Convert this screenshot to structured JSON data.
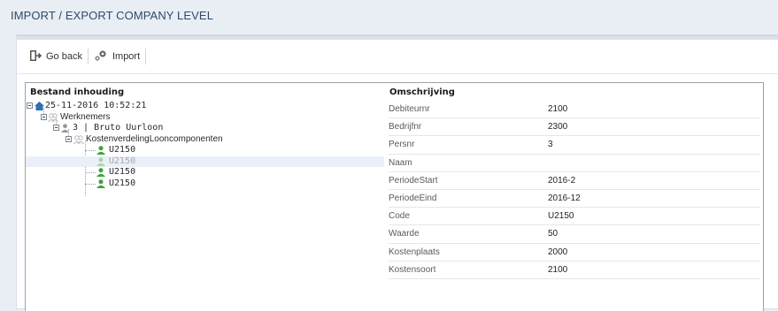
{
  "page": {
    "title": "IMPORT / EXPORT COMPANY LEVEL"
  },
  "toolbar": {
    "go_back_label": "Go back",
    "import_label": "Import"
  },
  "tree": {
    "header": "Bestand inhouding",
    "root": "25-11-2016 10:52:21",
    "werknemers": "Werknemers",
    "employee": "3 | Bruto Uurloon",
    "kostenverdeling": "KostenverdelingLooncomponenten",
    "items": [
      "U2150",
      "U2150",
      "U2150",
      "U2150"
    ]
  },
  "properties": {
    "header": "Omschrijving",
    "rows": [
      {
        "name": "Debiteurnr",
        "value": "2100"
      },
      {
        "name": "Bedrijfnr",
        "value": "2300"
      },
      {
        "name": "Persnr",
        "value": "3"
      },
      {
        "name": "Naam",
        "value": ""
      },
      {
        "name": "PeriodeStart",
        "value": "2016-2"
      },
      {
        "name": "PeriodeEind",
        "value": "2016-12"
      },
      {
        "name": "Code",
        "value": "U2150"
      },
      {
        "name": "Waarde",
        "value": "50"
      },
      {
        "name": "Kostenplaats",
        "value": "2000"
      },
      {
        "name": "Kostensoort",
        "value": "2100"
      }
    ]
  },
  "colors": {
    "title": "#2e4a6b",
    "accent": "#2f6fb0",
    "user_green": "#3aa53a"
  }
}
